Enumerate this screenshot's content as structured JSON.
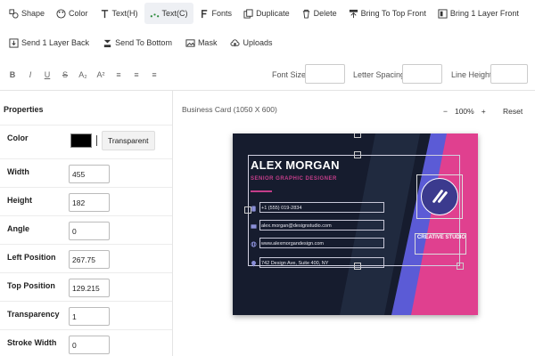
{
  "toolbar": {
    "row1": [
      {
        "label": "Shape",
        "icon": "shape-icon"
      },
      {
        "label": "Color",
        "icon": "palette-icon"
      },
      {
        "label": "Text(H)",
        "icon": "text-h-icon"
      },
      {
        "label": "Text(C)",
        "icon": "text-c-icon",
        "active": true
      },
      {
        "label": "Fonts",
        "icon": "font-icon"
      },
      {
        "label": "Duplicate",
        "icon": "duplicate-icon"
      },
      {
        "label": "Delete",
        "icon": "trash-icon"
      },
      {
        "label": "Bring To Top Front",
        "icon": "bring-top-icon"
      },
      {
        "label": "Bring 1 Layer Front",
        "icon": "bring-forward-icon"
      }
    ],
    "row2": [
      {
        "label": "Send 1 Layer Back",
        "icon": "send-backward-icon"
      },
      {
        "label": "Send To Bottom",
        "icon": "send-bottom-icon"
      },
      {
        "label": "Mask",
        "icon": "mask-icon"
      },
      {
        "label": "Uploads",
        "icon": "cloud-upload-icon"
      }
    ]
  },
  "format_bar": {
    "buttons": [
      "B",
      "I",
      "U",
      "S",
      "A₂",
      "A²",
      "≡",
      "≡",
      "≡"
    ],
    "font_size_label": "Font Size",
    "letter_spacing_label": "Letter Spacing",
    "line_height_label": "Line Height"
  },
  "properties": {
    "title": "Properties",
    "color_label": "Color",
    "transparent_label": "Transparent",
    "fields": [
      {
        "label": "Width",
        "value": "455"
      },
      {
        "label": "Height",
        "value": "182"
      },
      {
        "label": "Angle",
        "value": "0"
      },
      {
        "label": "Left Position",
        "value": "267.75"
      },
      {
        "label": "Top Position",
        "value": "129.215"
      },
      {
        "label": "Transparency",
        "value": "1"
      },
      {
        "label": "Stroke Width",
        "value": "0"
      }
    ]
  },
  "canvas": {
    "title": "Business Card (1050 X 600)",
    "zoom_minus": "−",
    "zoom_value": "100%",
    "zoom_plus": "+",
    "reset_label": "Reset"
  },
  "card": {
    "name": "ALEX MORGAN",
    "title": "SENIOR GRAPHIC DESIGNER",
    "contacts": [
      {
        "icon": "phone-icon",
        "text": "+1 (555) 019-2834"
      },
      {
        "icon": "email-icon",
        "text": "alex.morgan@designstudio.com"
      },
      {
        "icon": "globe-icon",
        "text": "www.alexmorgandesign.com"
      },
      {
        "icon": "location-icon",
        "text": "742 Design Ave, Suite 400, NY"
      }
    ],
    "studio": "CREATIVE STUDIO",
    "colors": {
      "background": "#161c2e",
      "accent_pink": "#e0408f",
      "accent_purple": "#5b5bd6"
    }
  }
}
